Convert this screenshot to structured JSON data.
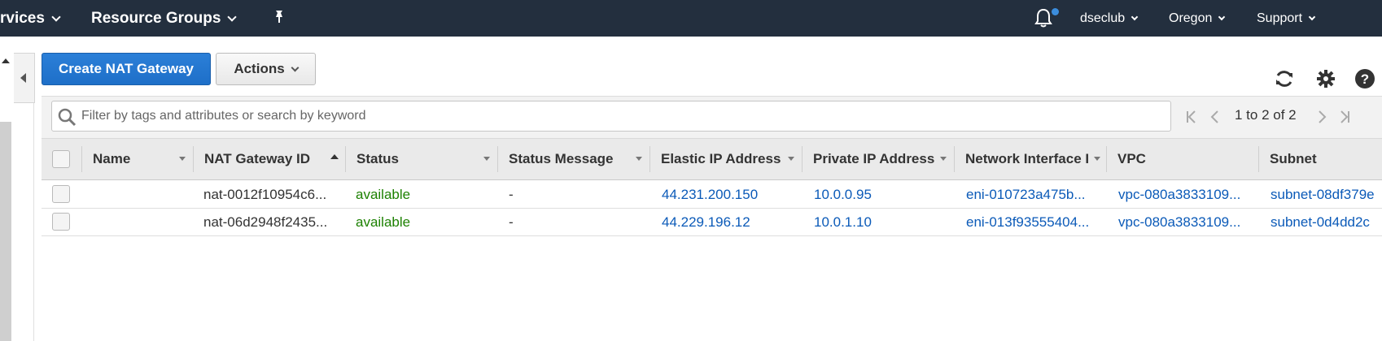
{
  "topnav": {
    "services_label": "rvices",
    "resource_groups_label": "Resource Groups",
    "account_label": "dseclub",
    "region_label": "Oregon",
    "support_label": "Support"
  },
  "toolbar": {
    "create_label": "Create NAT Gateway",
    "actions_label": "Actions"
  },
  "search": {
    "placeholder": "Filter by tags and attributes or search by keyword"
  },
  "pagination": {
    "text": "1 to 2 of 2"
  },
  "table": {
    "columns": [
      {
        "label": "Name"
      },
      {
        "label": "NAT Gateway ID"
      },
      {
        "label": "Status"
      },
      {
        "label": "Status Message"
      },
      {
        "label": "Elastic IP Address"
      },
      {
        "label": "Private IP Address"
      },
      {
        "label": "Network Interface I"
      },
      {
        "label": "VPC"
      },
      {
        "label": "Subnet"
      }
    ],
    "rows": [
      {
        "name": "",
        "id": "nat-0012f10954c6...",
        "status": "available",
        "message": "-",
        "eip": "44.231.200.150",
        "private_ip": "10.0.0.95",
        "eni": "eni-010723a475b...",
        "vpc": "vpc-080a3833109...",
        "subnet": "subnet-08df379e"
      },
      {
        "name": "",
        "id": "nat-06d2948f2435...",
        "status": "available",
        "message": "-",
        "eip": "44.229.196.12",
        "private_ip": "10.0.1.10",
        "eni": "eni-013f93555404...",
        "vpc": "vpc-080a3833109...",
        "subnet": "subnet-0d4dd2c"
      }
    ]
  },
  "colors": {
    "nav_bg": "#232f3e",
    "primary_button": "#1e6fc8",
    "status_available": "#1d8102",
    "link": "#0b5ab8"
  },
  "icons": [
    "bell-icon",
    "pin-icon",
    "refresh-icon",
    "settings-icon",
    "help-icon",
    "search-icon",
    "first-page-icon",
    "previous-page-icon",
    "next-page-icon",
    "last-page-icon"
  ]
}
